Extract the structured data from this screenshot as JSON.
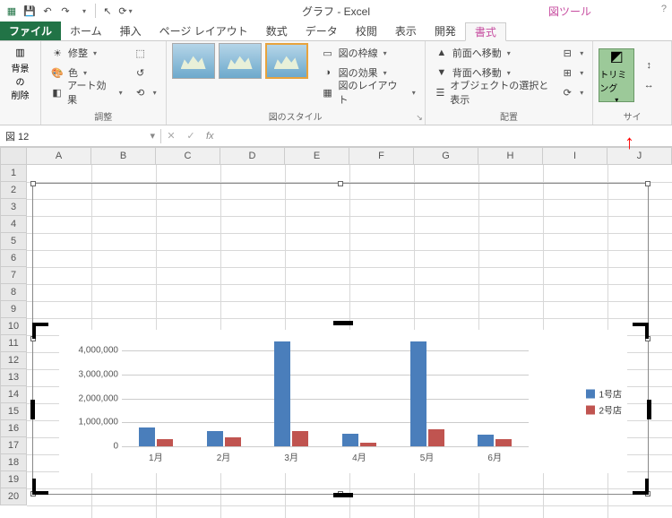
{
  "title": "グラフ - Excel",
  "tool_context": "図ツール",
  "tabs": {
    "file": "ファイル",
    "home": "ホーム",
    "insert": "挿入",
    "pagelayout": "ページ レイアウト",
    "formulas": "数式",
    "data": "データ",
    "review": "校閲",
    "view": "表示",
    "developer": "開発",
    "format": "書式"
  },
  "ribbon": {
    "bgremove": "背景の\n削除",
    "corrections": "修整",
    "color": "色",
    "artistic": "アート効果",
    "adjust_label": "調整",
    "style_label": "図のスタイル",
    "border": "図の枠線",
    "effects": "図の効果",
    "layout": "図のレイアウト",
    "bringfwd": "前面へ移動",
    "sendback": "背面へ移動",
    "selection": "オブジェクトの選択と表示",
    "arrange_label": "配置",
    "crop": "トリミング",
    "size_label": "サイ"
  },
  "namebox": "図 12",
  "columns": [
    "A",
    "B",
    "C",
    "D",
    "E",
    "F",
    "G",
    "H",
    "I",
    "J"
  ],
  "rows": [
    "1",
    "2",
    "3",
    "4",
    "5",
    "6",
    "7",
    "8",
    "9",
    "10",
    "11",
    "12",
    "13",
    "14",
    "15",
    "16",
    "17",
    "18",
    "19",
    "20"
  ],
  "chart_data": {
    "type": "bar",
    "categories": [
      "1月",
      "2月",
      "3月",
      "4月",
      "5月",
      "6月"
    ],
    "series": [
      {
        "name": "1号店",
        "values": [
          800000,
          620000,
          4400000,
          520000,
          4400000,
          500000
        ]
      },
      {
        "name": "2号店",
        "values": [
          310000,
          380000,
          640000,
          150000,
          730000,
          290000
        ]
      }
    ],
    "ylim": [
      0,
      4500000
    ],
    "yticks": [
      0,
      1000000,
      2000000,
      3000000,
      4000000
    ],
    "ytick_labels": [
      "0",
      "1,000,000",
      "2,000,000",
      "3,000,000",
      "4,000,000"
    ]
  }
}
